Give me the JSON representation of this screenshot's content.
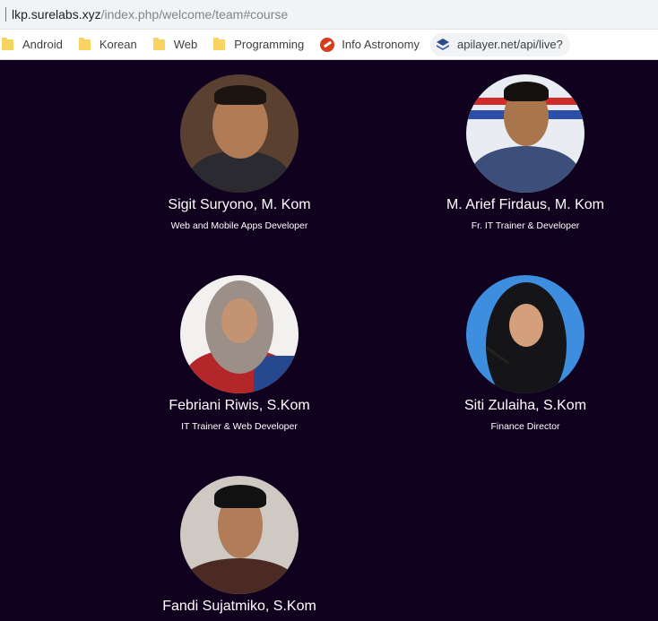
{
  "browser": {
    "url_host": "lkp.surelabs.xyz",
    "url_path": "/index.php/welcome/team#course",
    "bookmarks": [
      {
        "label": "Android",
        "icon": "folder-icon"
      },
      {
        "label": "Korean",
        "icon": "folder-icon"
      },
      {
        "label": "Web",
        "icon": "folder-icon"
      },
      {
        "label": "Programming",
        "icon": "folder-icon"
      },
      {
        "label": "Info Astronomy",
        "icon": "astronomy-icon"
      },
      {
        "label": "apilayer.net/api/live?",
        "icon": "layers-icon"
      }
    ]
  },
  "team": [
    {
      "name": "Sigit Suryono, M. Kom",
      "role": "Web and Mobile Apps Developer",
      "photo": "portrait-photo"
    },
    {
      "name": "M. Arief Firdaus, M. Kom",
      "role": "Fr. IT Trainer & Developer",
      "photo": "portrait-photo"
    },
    {
      "name": "Febriani Riwis, S.Kom",
      "role": "IT Trainer & Web Developer",
      "photo": "portrait-photo"
    },
    {
      "name": "Siti Zulaiha, S.Kom",
      "role": "Finance Director",
      "photo": "portrait-photo"
    },
    {
      "name": "Fandi Sujatmiko, S.Kom",
      "role": "",
      "photo": "portrait-photo"
    }
  ],
  "colors": {
    "page_bg": "#10011e",
    "text": "#ffffff"
  }
}
